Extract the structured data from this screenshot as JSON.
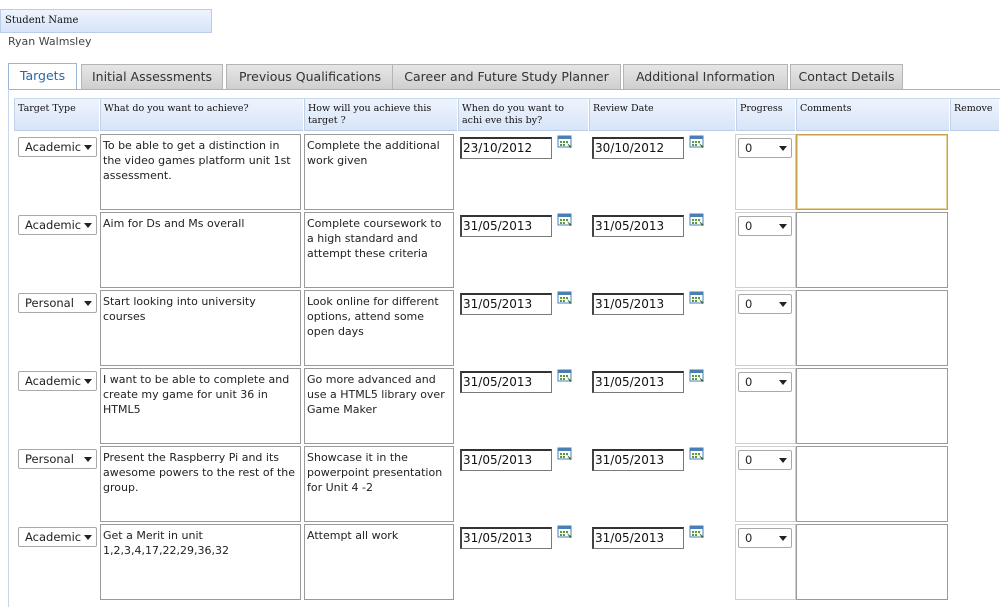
{
  "student": {
    "header": "Student Name",
    "name": "Ryan Walmsley"
  },
  "tabs": [
    {
      "label": "Targets",
      "active": true
    },
    {
      "label": "Initial Assessments"
    },
    {
      "label": "Previous Qualifications"
    },
    {
      "label": "Career and Future Study Planner"
    },
    {
      "label": "Additional Information"
    },
    {
      "label": "Contact Details"
    }
  ],
  "columns": [
    "Target Type",
    "What do you want to achieve?",
    "How will you achieve this target ?",
    "When do you want to achi eve this by?",
    "Review Date",
    "Progress",
    "Comments",
    "Remove"
  ],
  "rows": [
    {
      "type": "Academic",
      "achieve": "To be able to get a distinction in the video games platform unit 1st assessment.",
      "how": "Complete the additional work given",
      "when": "23/10/2012",
      "review": "30/10/2012",
      "progress": "0",
      "comments": ""
    },
    {
      "type": "Academic",
      "achieve": "Aim for Ds and Ms overall",
      "how": "Complete coursework to a high standard and attempt these criteria",
      "when": "31/05/2013",
      "review": "31/05/2013",
      "progress": "0",
      "comments": ""
    },
    {
      "type": "Personal",
      "achieve": "Start looking into university courses",
      "how": "Look online for different options, attend some open days",
      "when": "31/05/2013",
      "review": "31/05/2013",
      "progress": "0",
      "comments": ""
    },
    {
      "type": "Academic",
      "achieve": "I want to be able to complete and create my game for unit 36 in HTML5",
      "how": "Go more advanced and use a HTML5 library over Game Maker",
      "when": "31/05/2013",
      "review": "31/05/2013",
      "progress": "0",
      "comments": ""
    },
    {
      "type": "Personal",
      "achieve": "Present the Raspberry Pi and its awesome powers to the rest of the group.",
      "how": "Showcase it in the powerpoint presentation for Unit 4 -2",
      "when": "31/05/2013",
      "review": "31/05/2013",
      "progress": "0",
      "comments": ""
    },
    {
      "type": "Academic",
      "achieve": "Get a Merit in unit 1,2,3,4,17,22,29,36,32",
      "how": "Attempt all work",
      "when": "31/05/2013",
      "review": "31/05/2013",
      "progress": "0",
      "comments": ""
    }
  ],
  "icons": {
    "calendar": "calendar-icon",
    "dropdown": "chevron-down-icon"
  }
}
